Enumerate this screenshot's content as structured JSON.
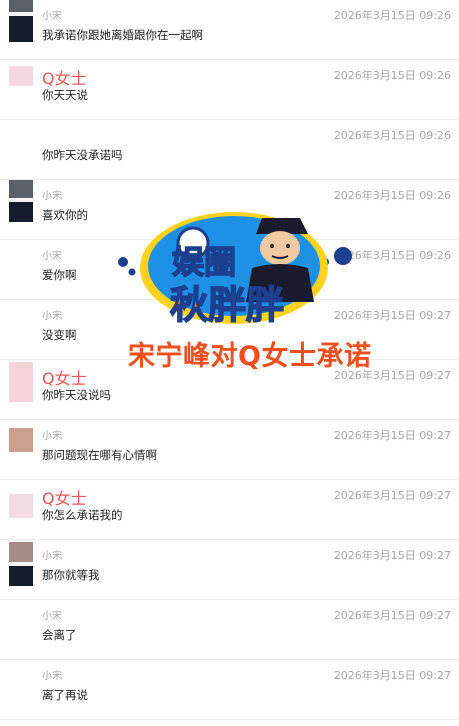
{
  "messages": [
    {
      "sender": "小宋",
      "time": "2026年3月15日 09:26",
      "text": "我承诺你跟她离婚跟你在一起啊"
    },
    {
      "sender": "Q女士",
      "time": "2026年3月15日 09:26",
      "text": "你天天说"
    },
    {
      "sender": "",
      "time": "2026年3月15日 09:26",
      "text": "你昨天没承诺吗"
    },
    {
      "sender": "小宋",
      "time": "2026年3月15日 09:26",
      "text": "喜欢你的"
    },
    {
      "sender": "小宋",
      "time": "2026年3月15日 09:26",
      "text": "爱你啊"
    },
    {
      "sender": "小宋",
      "time": "2026年3月15日 09:27",
      "text": "没变啊"
    },
    {
      "sender": "Q女士",
      "time": "2026年3月15日 09:27",
      "text": "你昨天没说吗"
    },
    {
      "sender": "小宋",
      "time": "2026年3月15日 09:27",
      "text": "那问题现在哪有心情啊"
    },
    {
      "sender": "Q女士",
      "time": "2026年3月15日 09:27",
      "text": "你怎么承诺我的"
    },
    {
      "sender": "小宋",
      "time": "2026年3月15日 09:27",
      "text": "那你就等我"
    },
    {
      "sender": "小宋",
      "time": "2026年3月15日 09:27",
      "text": "会离了"
    },
    {
      "sender": "小宋",
      "time": "2026年3月15日 09:27",
      "text": "离了再说"
    }
  ],
  "overlay": {
    "logo_line1": "娱圈",
    "logo_line2": "秋胖胖",
    "caption": "宋宁峰对Q女士承诺"
  },
  "colors": {
    "logo_bg": "#1e90e6",
    "logo_ring": "#ffd21f",
    "caption": "#ef4f1c",
    "q_name": "#e05a5a"
  }
}
